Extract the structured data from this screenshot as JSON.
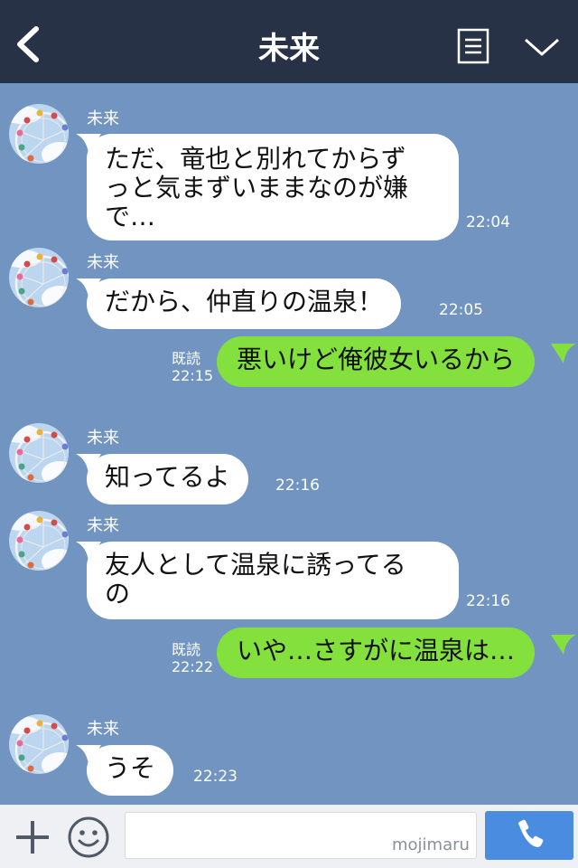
{
  "header": {
    "title": "未来",
    "back_icon": "chevron-left-icon",
    "menu_icon": "list-icon",
    "more_icon": "chevron-down-icon"
  },
  "messages": [
    {
      "type": "in",
      "sender": "未来",
      "line1": "ただ、竜也と別れてからず",
      "line2": "っと気まずいままなのが嫌",
      "line3": "で…",
      "time": "22:04"
    },
    {
      "type": "in",
      "sender": "未来",
      "text": "だから、仲直りの温泉！",
      "time": "22:05"
    },
    {
      "type": "out",
      "text": "悪いけど俺彼女いるから",
      "read": "既読",
      "time": "22:15"
    },
    {
      "type": "in",
      "sender": "未来",
      "text": "知ってるよ",
      "time": "22:16"
    },
    {
      "type": "in",
      "sender": "未来",
      "line1": "友人として温泉に誘ってる",
      "line2": "の",
      "time": "22:16"
    },
    {
      "type": "out",
      "text": "いや…さすがに温泉は…",
      "read": "既読",
      "time": "22:22"
    },
    {
      "type": "in",
      "sender": "未来",
      "text": "うそ",
      "time": "22:23"
    }
  ],
  "input": {
    "plus_icon": "plus-icon",
    "emoji_icon": "smiley-icon",
    "value": "",
    "watermark": "mojimaru",
    "call_icon": "phone-icon"
  },
  "colors": {
    "header": "#273247",
    "background": "#7194c0",
    "incoming": "#ffffff",
    "outgoing": "#84e13d",
    "call_button": "#4a8de0"
  }
}
